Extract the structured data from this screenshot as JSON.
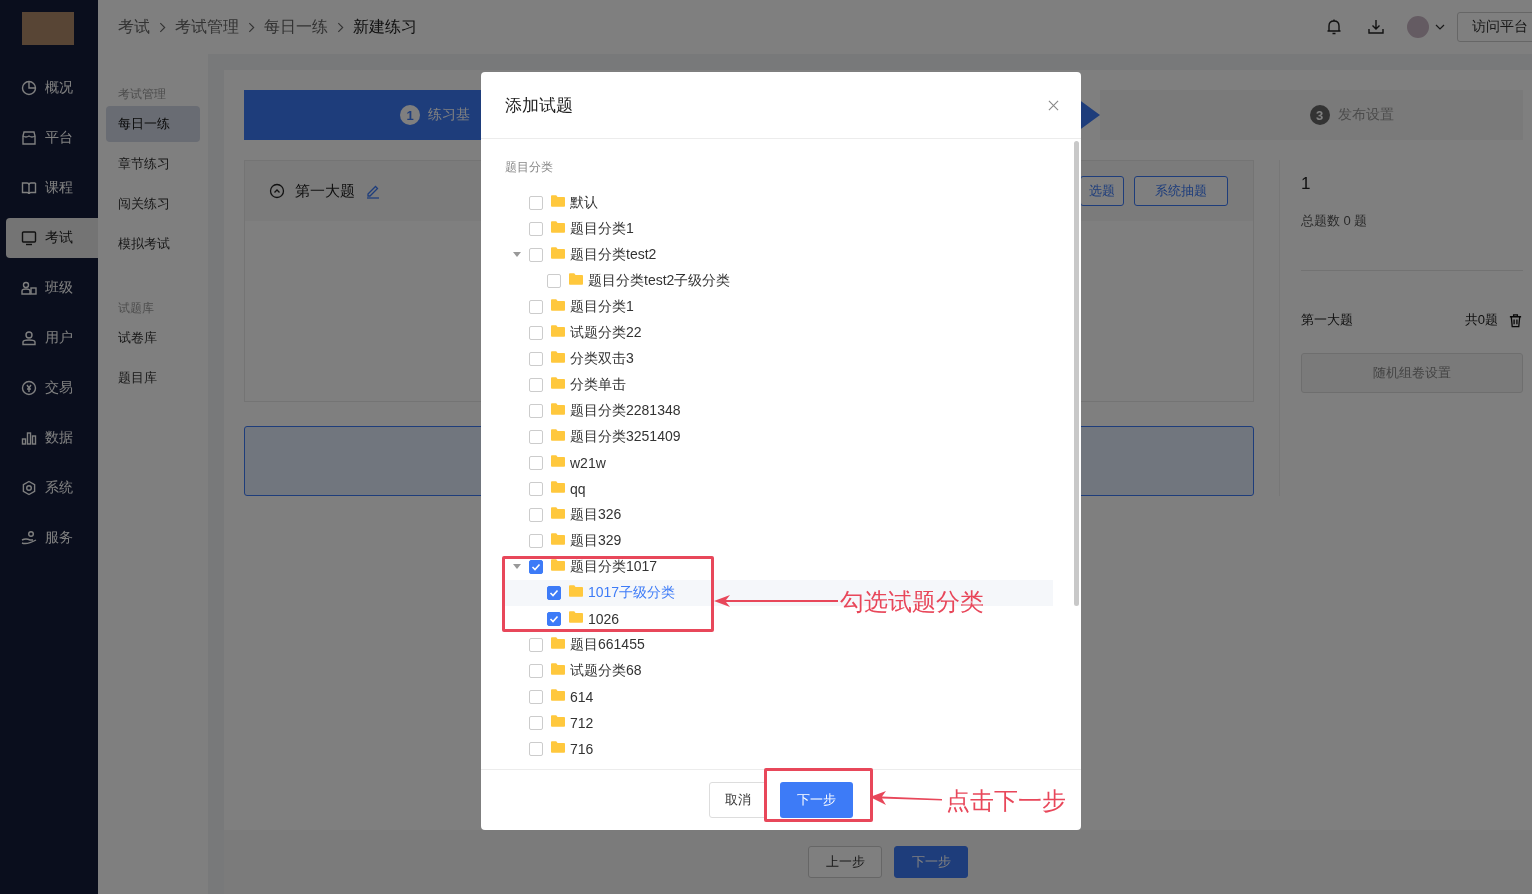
{
  "sidebar": {
    "items": [
      {
        "label": "概况",
        "selected": false
      },
      {
        "label": "平台",
        "selected": false
      },
      {
        "label": "课程",
        "selected": false
      },
      {
        "label": "考试",
        "selected": true
      },
      {
        "label": "班级",
        "selected": false
      },
      {
        "label": "用户",
        "selected": false
      },
      {
        "label": "交易",
        "selected": false
      },
      {
        "label": "数据",
        "selected": false
      },
      {
        "label": "系统",
        "selected": false
      },
      {
        "label": "服务",
        "selected": false
      }
    ]
  },
  "header": {
    "breadcrumb": [
      "考试",
      "考试管理",
      "每日一练",
      "新建练习"
    ],
    "visit_button": "访问平台"
  },
  "submenu": {
    "groups": [
      {
        "title": "考试管理",
        "items": [
          {
            "label": "每日一练",
            "selected": true
          },
          {
            "label": "章节练习",
            "selected": false
          },
          {
            "label": "闯关练习",
            "selected": false
          },
          {
            "label": "模拟考试",
            "selected": false
          }
        ]
      },
      {
        "title": "试题库",
        "items": [
          {
            "label": "试卷库",
            "selected": false
          },
          {
            "label": "题目库",
            "selected": false
          }
        ]
      }
    ]
  },
  "steps": [
    {
      "number": "1",
      "label": "练习基",
      "selected": true
    },
    {
      "number": "3",
      "label": "发布设置",
      "selected": false
    }
  ],
  "section": {
    "title": "第一大题",
    "buttons": [
      "选题",
      "系统抽题"
    ]
  },
  "summary": {
    "count": "1",
    "total": "总题数 0 题",
    "section_title": "第一大题",
    "section_count": "共0题",
    "random_button": "随机组卷设置"
  },
  "footer": {
    "prev": "上一步",
    "next": "下一步"
  },
  "dialog": {
    "title": "添加试题",
    "tree_label": "题目分类",
    "tree": [
      {
        "label": "默认",
        "checked": false,
        "selected": false
      },
      {
        "label": "题目分类1",
        "checked": false,
        "selected": false
      },
      {
        "label": "题目分类test2",
        "checked": false,
        "selected": false,
        "expanded": true,
        "children": [
          {
            "label": "题目分类test2子级分类",
            "checked": false,
            "selected": false
          }
        ]
      },
      {
        "label": "题目分类1",
        "checked": false,
        "selected": false
      },
      {
        "label": "试题分类22",
        "checked": false,
        "selected": false
      },
      {
        "label": "分类双击3",
        "checked": false,
        "selected": false
      },
      {
        "label": "分类单击",
        "checked": false,
        "selected": false
      },
      {
        "label": "题目分类2281348",
        "checked": false,
        "selected": false
      },
      {
        "label": "题目分类3251409",
        "checked": false,
        "selected": false
      },
      {
        "label": "w21w",
        "checked": false,
        "selected": false
      },
      {
        "label": "qq",
        "checked": false,
        "selected": false
      },
      {
        "label": "题目326",
        "checked": false,
        "selected": false
      },
      {
        "label": "题目329",
        "checked": false,
        "selected": false
      },
      {
        "label": "题目分类1017",
        "checked": true,
        "selected": false,
        "expanded": true,
        "children": [
          {
            "label": "1017子级分类",
            "checked": true,
            "selected": true
          },
          {
            "label": "1026",
            "checked": true,
            "selected": false
          }
        ]
      },
      {
        "label": "题目661455",
        "checked": false,
        "selected": false
      },
      {
        "label": "试题分类68",
        "checked": false,
        "selected": false
      },
      {
        "label": "614",
        "checked": false,
        "selected": false
      },
      {
        "label": "712",
        "checked": false,
        "selected": false
      },
      {
        "label": "716",
        "checked": false,
        "selected": false
      }
    ],
    "cancel_button": "取消",
    "confirm_button": "下一步"
  },
  "annotations": [
    {
      "text": "勾选试题分类"
    },
    {
      "text": "点击下一步"
    }
  ]
}
